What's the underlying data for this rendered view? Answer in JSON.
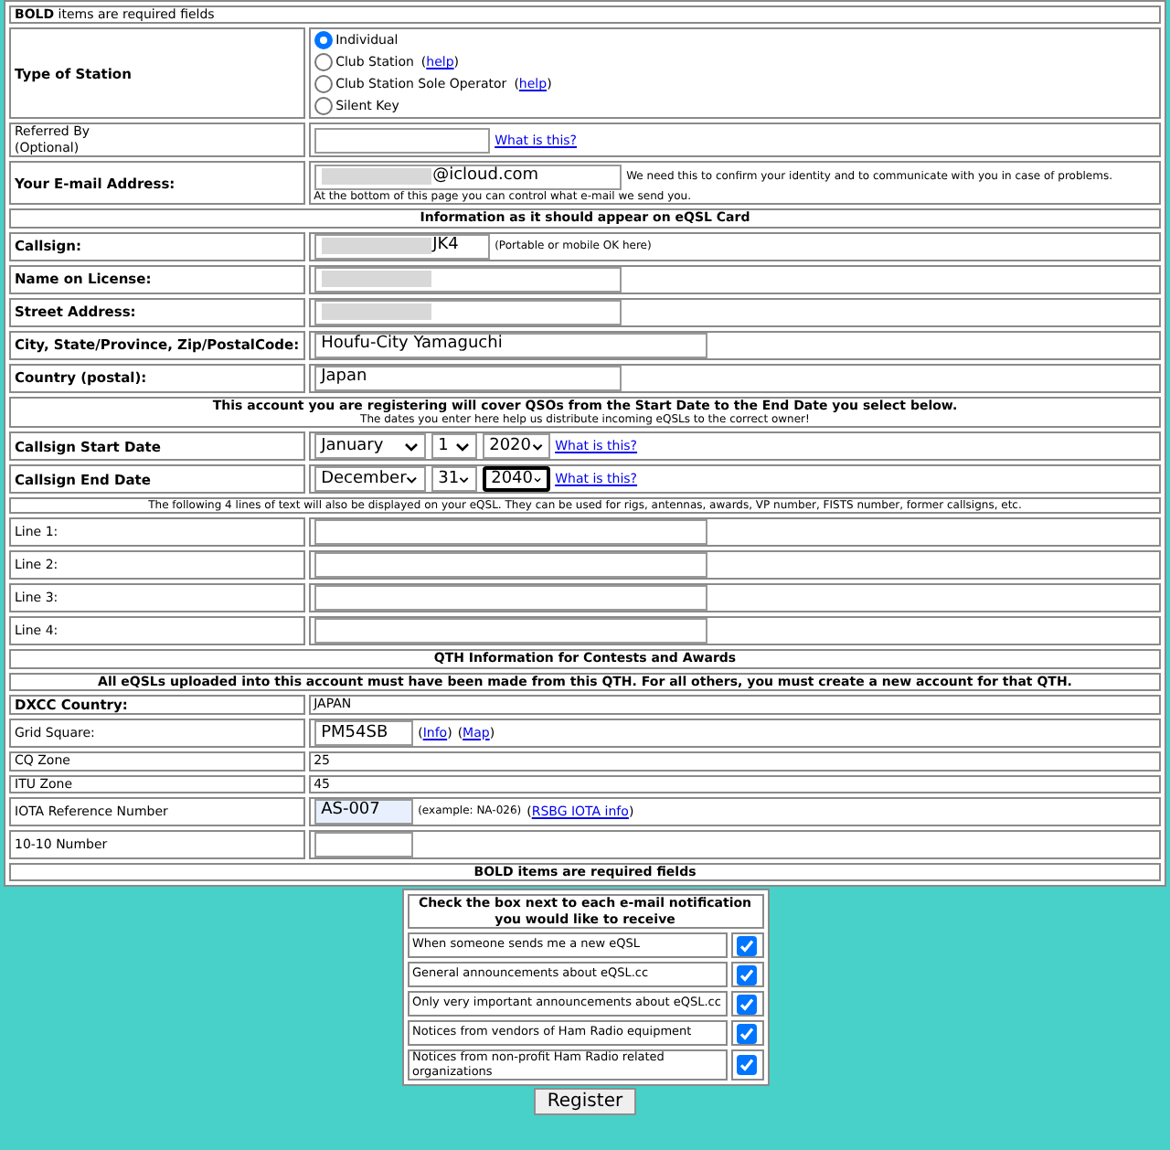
{
  "required_note": "**BOLD** items are required fields",
  "rows": [
    {
      "kind": "radio",
      "label": "Type of Station",
      "bold": true,
      "options": [
        {
          "label": "Individual",
          "selected": true
        },
        {
          "label": "Club Station",
          "selected": false,
          "help": {
            "open": "(",
            "text": "help",
            "close": ")"
          }
        },
        {
          "label": "Club Station Sole Operator",
          "selected": false,
          "help": {
            "open": "(",
            "text": "help",
            "close": ")"
          }
        },
        {
          "label": "Silent Key",
          "selected": false
        }
      ]
    },
    {
      "kind": "shortfield",
      "label": "Referred By",
      "sublabel": "(Optional)",
      "bold": false,
      "link": {
        "text": "What is this?"
      }
    },
    {
      "kind": "field",
      "label": "Your E-mail Address:",
      "bold": true,
      "value": "@icloud.com",
      "redacted": true,
      "note": "We need this to confirm your identity and to communicate with you in case of problems.",
      "note2": "At the bottom of this page you can control what e-mail we send you."
    },
    {
      "kind": "header",
      "title": "Information as it should appear on eQSL Card",
      "bold": true
    },
    {
      "kind": "shortfield",
      "label": "Callsign:",
      "bold": true,
      "value": "JK4",
      "redacted": true,
      "note": "(Portable or mobile OK here)"
    },
    {
      "kind": "field",
      "label": "Name on License:",
      "bold": true,
      "redacted": true
    },
    {
      "kind": "field",
      "label": "Street Address:",
      "bold": true,
      "redacted": true
    },
    {
      "kind": "longfield",
      "label": "City, State/Province, Zip/PostalCode:",
      "bold": true,
      "value": "Houfu-City Yamaguchi"
    },
    {
      "kind": "field",
      "label": "Country (postal):",
      "bold": true,
      "value": "Japan"
    },
    {
      "kind": "header",
      "title": "This account you are registering will cover QSOs from the Start Date to the End Date you select below.",
      "subtitle": "The dates you enter here help us distribute incoming eQSLs to the correct owner!",
      "bold": true
    },
    {
      "kind": "date",
      "label": "Callsign Start Date",
      "bold": true,
      "month": "January",
      "day": "1",
      "year": "2020",
      "focused": false,
      "link": {
        "text": "What is this?"
      }
    },
    {
      "kind": "date",
      "label": "Callsign End Date",
      "bold": true,
      "month": "December",
      "day": "31",
      "year": "2040",
      "focused": true,
      "link": {
        "text": "What is this?"
      }
    },
    {
      "kind": "header",
      "title": "The following 4 lines of text will also be displayed on your eQSL. They can be used for rigs, antennas, awards, VP number, FISTS number, former callsigns, etc.",
      "bold": false
    },
    {
      "kind": "longfield",
      "label": "Line 1:",
      "bold": false
    },
    {
      "kind": "longfield",
      "label": "Line 2:",
      "bold": false
    },
    {
      "kind": "longfield",
      "label": "Line 3:",
      "bold": false
    },
    {
      "kind": "longfield",
      "label": "Line 4:",
      "bold": false
    },
    {
      "kind": "header",
      "title": "QTH Information for Contests and Awards",
      "bold": true
    },
    {
      "kind": "header",
      "title": "All eQSLs uploaded into this account must have been made from this QTH. For all others, you must create a new account for that QTH.",
      "bold": true
    },
    {
      "kind": "plain",
      "label": "DXCC Country:",
      "bold": true,
      "value": "JAPAN"
    },
    {
      "kind": "tinyfield",
      "label": "Grid Square:",
      "bold": false,
      "value": "PM54SB",
      "links": [
        {
          "open": "(",
          "text": "Info",
          "close": ")"
        },
        {
          "open": "(",
          "text": "Map",
          "close": ")"
        }
      ]
    },
    {
      "kind": "plain",
      "label": "CQ Zone",
      "bold": false,
      "value": "25"
    },
    {
      "kind": "plain",
      "label": "ITU Zone",
      "bold": false,
      "value": "45"
    },
    {
      "kind": "tinyfield",
      "label": "IOTA Reference Number",
      "bold": false,
      "value": "AS-007",
      "autofilled": true,
      "note": "(example: NA-026)",
      "links": [
        {
          "open": "(",
          "text": "RSBG IOTA info",
          "close": ")"
        }
      ]
    },
    {
      "kind": "tinyfield",
      "label": "10-10 Number",
      "bold": false
    },
    {
      "kind": "header",
      "title": "BOLD items are required fields",
      "bold": true
    }
  ],
  "notifications": {
    "title": "Check the box next to each e-mail notification you would like to receive",
    "items": [
      {
        "label": "When someone sends me a new eQSL",
        "checked": true
      },
      {
        "label": "General announcements about eQSL.cc",
        "checked": true
      },
      {
        "label": "Only very important announcements about eQSL.cc",
        "checked": true
      },
      {
        "label": "Notices from vendors of Ham Radio equipment",
        "checked": true
      },
      {
        "label": "Notices from non-profit Ham Radio related organizations",
        "checked": true
      }
    ]
  },
  "register_button": "Register"
}
